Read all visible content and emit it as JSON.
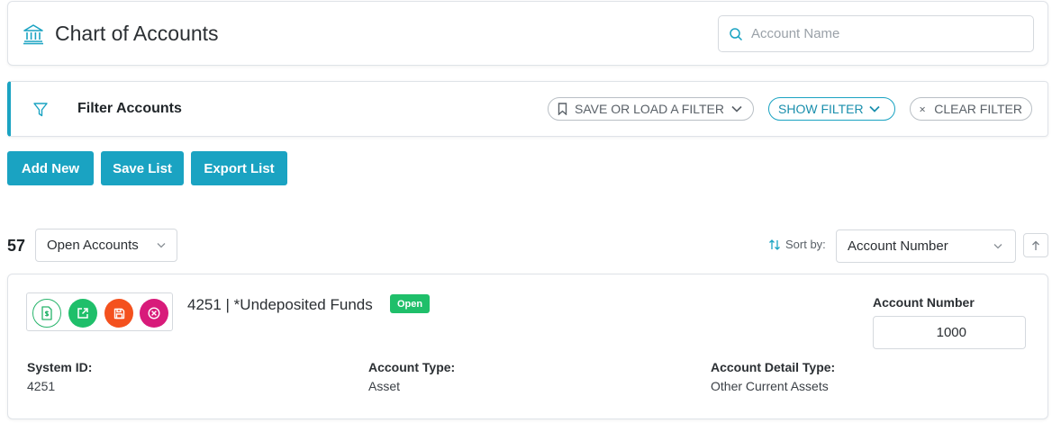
{
  "header": {
    "title": "Chart of Accounts",
    "title_icon": "bank-icon",
    "search_placeholder": "Account Name",
    "search_value": ""
  },
  "filter": {
    "title": "Filter Accounts",
    "save_load_label": "SAVE OR LOAD A FILTER",
    "show_filter_label": "SHOW FILTER",
    "clear_filter_label": "CLEAR FILTER"
  },
  "toolbar": {
    "add_new_label": "Add New",
    "save_list_label": "Save List",
    "export_list_label": "Export List"
  },
  "list": {
    "count": "57",
    "view_selected": "Open Accounts",
    "sort_label": "Sort by:",
    "sort_selected": "Account Number"
  },
  "accounts": [
    {
      "name": "4251 | *Undeposited Funds",
      "status": "Open",
      "account_number_label": "Account Number",
      "account_number": "1000",
      "fields": [
        {
          "label": "System ID:",
          "value": "4251"
        },
        {
          "label": "Account Type:",
          "value": "Asset"
        },
        {
          "label": "Account Detail Type:",
          "value": "Other Current Assets"
        }
      ]
    }
  ],
  "colors": {
    "accent": "#1aa3c2",
    "status_open": "#1fbf6a",
    "action_green": "#1fbf6a",
    "action_orange": "#f4511e",
    "action_magenta": "#d81b7a"
  }
}
